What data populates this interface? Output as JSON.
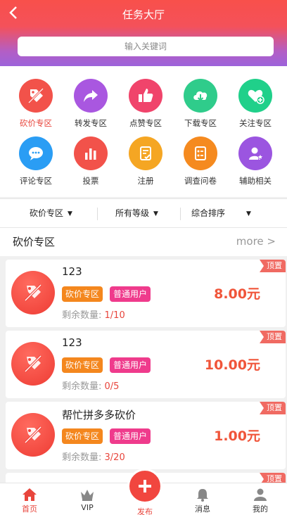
{
  "header": {
    "back_icon": "chevron-left-icon",
    "title": "任务大厅",
    "search_placeholder": "输入关键词"
  },
  "categories": [
    {
      "label": "砍价专区",
      "icon": "tag-slash-icon",
      "color": "#f2524a",
      "active": true
    },
    {
      "label": "转发专区",
      "icon": "share-arrow-icon",
      "color": "#a957e0"
    },
    {
      "label": "点赞专区",
      "icon": "thumbs-up-icon",
      "color": "#f0446b"
    },
    {
      "label": "下载专区",
      "icon": "cloud-download-icon",
      "color": "#2fcc8b"
    },
    {
      "label": "关注专区",
      "icon": "heart-plus-icon",
      "color": "#20d08a"
    },
    {
      "label": "评论专区",
      "icon": "chat-bubble-icon",
      "color": "#2a9df4"
    },
    {
      "label": "投票",
      "icon": "bar-chart-icon",
      "color": "#f2524a"
    },
    {
      "label": "注册",
      "icon": "form-check-icon",
      "color": "#f5a623"
    },
    {
      "label": "调查问卷",
      "icon": "survey-list-icon",
      "color": "#f58a1f"
    },
    {
      "label": "辅助相关",
      "icon": "user-star-icon",
      "color": "#9b55e0"
    }
  ],
  "filters": {
    "category": "砍价专区",
    "level": "所有等级",
    "sort": "综合排序"
  },
  "section": {
    "title": "砍价专区",
    "more": "more >"
  },
  "tasks": [
    {
      "title": "123",
      "tag1": "砍价专区",
      "tag2": "普通用户",
      "remain_label": "剩余数量:",
      "remain": "1/10",
      "price": "8.00元",
      "pin": "顶置"
    },
    {
      "title": "123",
      "tag1": "砍价专区",
      "tag2": "普通用户",
      "remain_label": "剩余数量:",
      "remain": "0/5",
      "price": "10.00元",
      "pin": "顶置"
    },
    {
      "title": "帮忙拼多多砍价",
      "tag1": "砍价专区",
      "tag2": "普通用户",
      "remain_label": "剩余数量:",
      "remain": "3/20",
      "price": "1.00元",
      "pin": "顶置"
    }
  ],
  "partial_card": {
    "pin": "顶置"
  },
  "tabbar": {
    "home": "首页",
    "vip": "VIP",
    "publish": "发布",
    "messages": "消息",
    "mine": "我的"
  },
  "colors": {
    "accent": "#e8453c",
    "price": "#f0553a",
    "tag_orange": "#f4871e",
    "tag_pink": "#ef3b8c"
  }
}
